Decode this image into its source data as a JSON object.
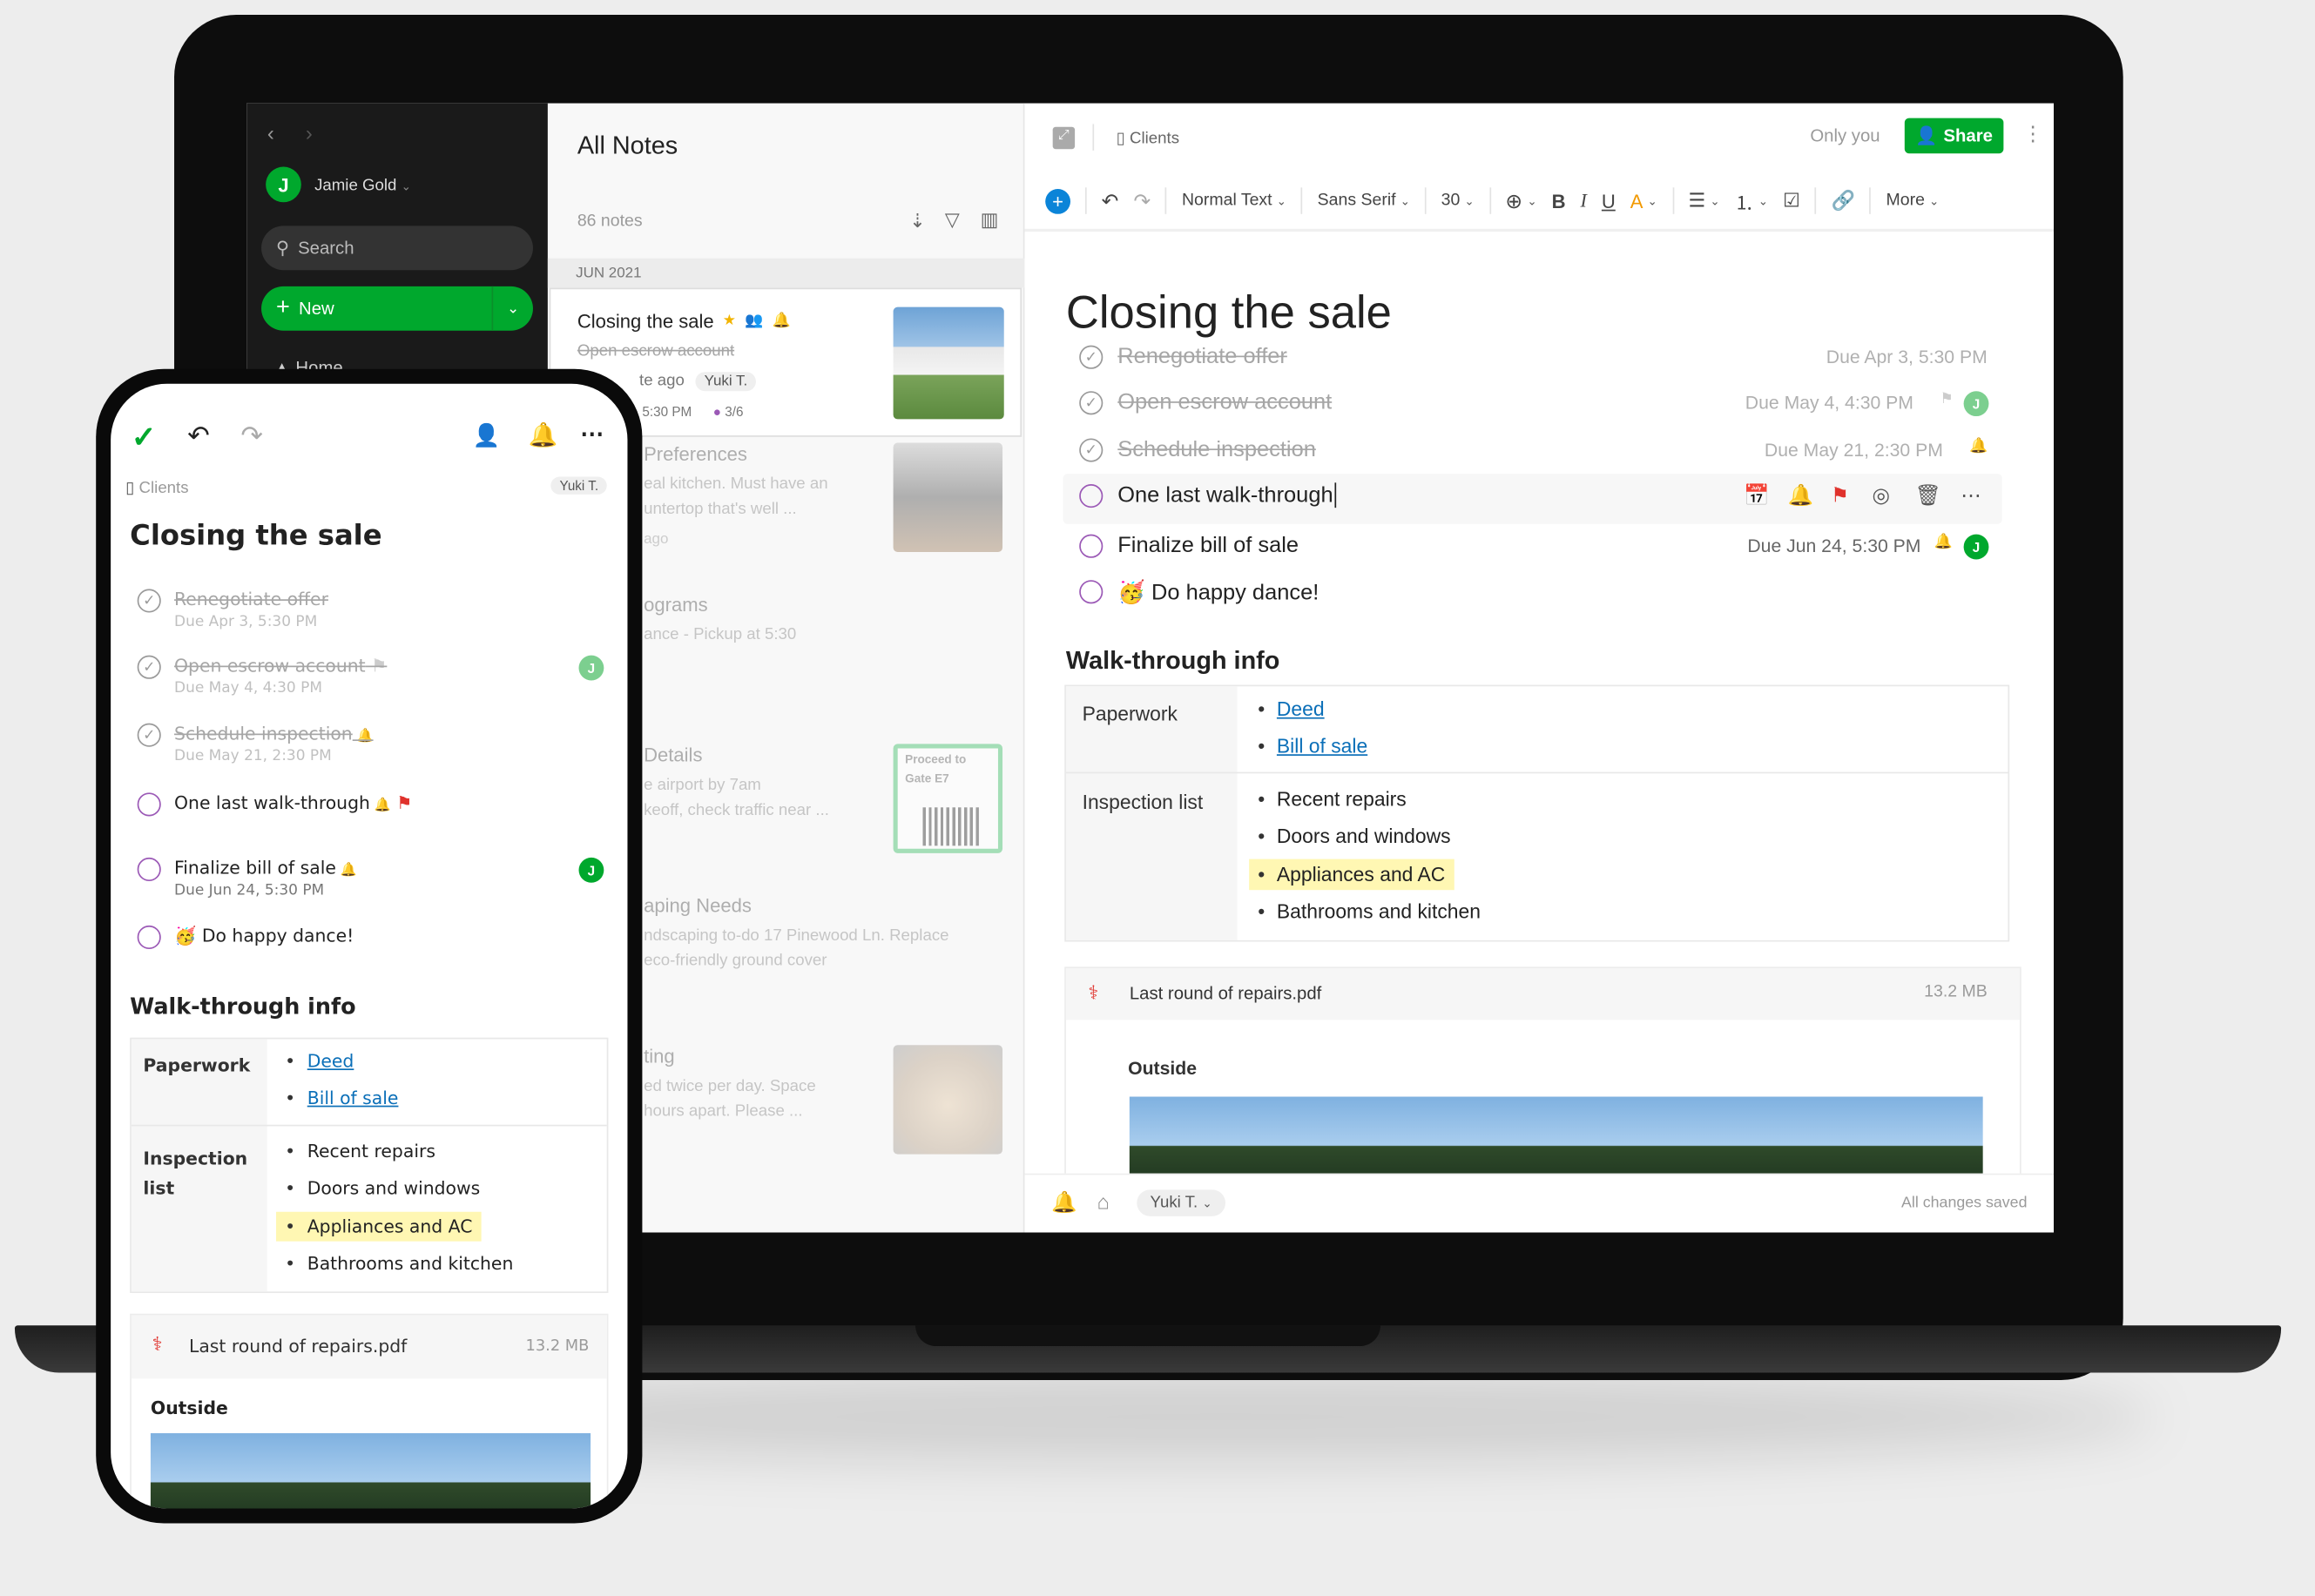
{
  "colors": {
    "brand_green": "#00a82d",
    "accent_blue": "#0b84d8",
    "flag_red": "#e0322c",
    "purple_check": "#9b59b6"
  },
  "sidebar": {
    "user_initial": "J",
    "user_name": "Jamie Gold",
    "search_placeholder": "Search",
    "new_label": "New",
    "home_label": "Home"
  },
  "notelist": {
    "title": "All Notes",
    "count": "86 notes",
    "group": "JUN 2021",
    "selected": {
      "title": "Closing the sale",
      "snippet": "Open escrow account",
      "time": "te ago",
      "chip": "Yuki T.",
      "due": "5:30 PM",
      "tasks": "3/6"
    },
    "items": [
      {
        "title": "Preferences",
        "lines": [
          "eal kitchen. Must have an",
          "untertop that's well ..."
        ],
        "meta": "ago",
        "thumb": "kitchen"
      },
      {
        "title": "ograms",
        "lines": [
          "ance - Pickup at 5:30"
        ],
        "meta": "",
        "thumb": ""
      },
      {
        "title": "Details",
        "lines": [
          "e airport by 7am",
          "keoff, check traffic near ..."
        ],
        "meta": "",
        "thumb": "boarding-pass",
        "thumb_text": [
          "Proceed to",
          "Gate E7"
        ]
      },
      {
        "title": "aping Needs",
        "lines": [
          "ndscaping to-do 17 Pinewood Ln. Replace",
          "eco-friendly ground cover"
        ],
        "meta": "",
        "thumb": ""
      },
      {
        "title": "ting",
        "lines": [
          "ed twice per day. Space",
          "hours apart. Please ..."
        ],
        "meta": "",
        "thumb": "dog"
      }
    ]
  },
  "editor": {
    "notebook": "Clients",
    "visibility": "Only you",
    "share_label": "Share",
    "toolbar": {
      "style": "Normal Text",
      "font": "Sans Serif",
      "size": "30",
      "bold": "B",
      "italic": "I",
      "underline": "U",
      "color": "A",
      "more": "More"
    },
    "title": "Closing the sale",
    "tasks": [
      {
        "text": "Renegotiate offer",
        "done": true,
        "due": "Due Apr 3, 5:30 PM",
        "assignee": ""
      },
      {
        "text": "Open escrow account",
        "done": true,
        "due": "Due May 4, 4:30 PM",
        "assignee": "J"
      },
      {
        "text": "Schedule inspection",
        "done": true,
        "due": "Due May 21, 2:30 PM",
        "assignee": ""
      },
      {
        "text": "One last walk-through",
        "done": false,
        "due": "",
        "assignee": ""
      },
      {
        "text": "Finalize bill of sale",
        "done": false,
        "due": "Due Jun 24, 5:30 PM",
        "assignee": "J"
      },
      {
        "text": "Do happy dance!",
        "done": false,
        "due": "",
        "assignee": "",
        "emoji": "🥳"
      }
    ],
    "section": "Walk-through info",
    "table": {
      "row1_label": "Paperwork",
      "row1_links": [
        "Deed",
        "Bill of sale"
      ],
      "row2_label": "Inspection list",
      "row2_items": [
        "Recent repairs",
        "Doors and windows",
        "Appliances and AC",
        "Bathrooms and kitchen"
      ]
    },
    "attachment": {
      "name": "Last round of repairs.pdf",
      "size": "13.2 MB",
      "caption": "Outside"
    },
    "footer": {
      "assignee": "Yuki T.",
      "status": "All changes saved"
    }
  },
  "phone": {
    "notebook": "Clients",
    "chip": "Yuki T."
  }
}
